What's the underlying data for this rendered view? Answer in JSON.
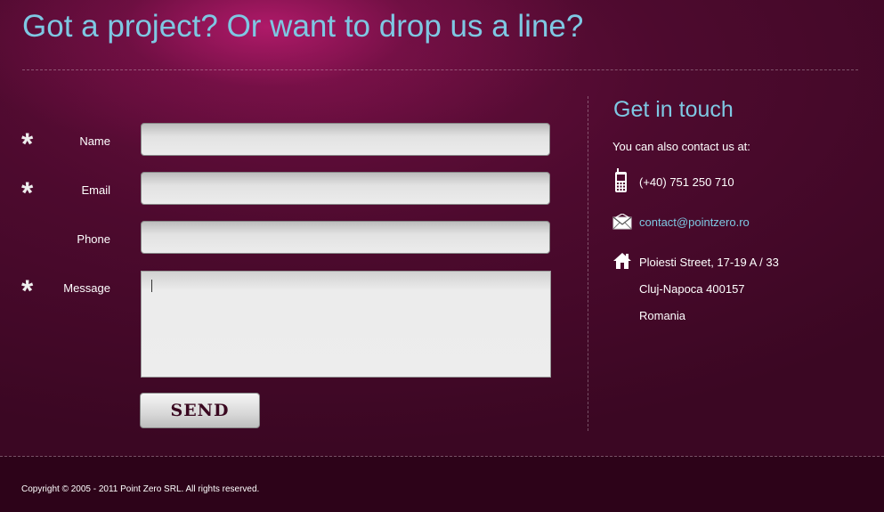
{
  "header": {
    "title": "Got a project? Or want to drop us a line?"
  },
  "form": {
    "required_marker": "*",
    "fields": [
      {
        "label": "Name",
        "value": "",
        "required": true
      },
      {
        "label": "Email",
        "value": "",
        "required": true
      },
      {
        "label": "Phone",
        "value": "",
        "required": false
      },
      {
        "label": "Message",
        "value": "",
        "required": true
      }
    ],
    "send_label": "SEND"
  },
  "contact": {
    "title": "Get in touch",
    "intro": "You can also contact us at:",
    "phone": "(+40) 751 250 710",
    "email": "contact@pointzero.ro",
    "address_lines": [
      "Ploiesti Street, 17-19 A / 33",
      "Cluj-Napoca 400157",
      "Romania"
    ],
    "icons": {
      "phone": "mobile-phone-icon",
      "email": "envelope-icon",
      "address": "home-icon"
    }
  },
  "footer": {
    "copyright": "Copyright © 2005 - 2011 Point Zero SRL. All rights reserved."
  },
  "colors": {
    "accent": "#7ec8e3",
    "background": "#4d0a2e",
    "footer": "#2d0319"
  }
}
